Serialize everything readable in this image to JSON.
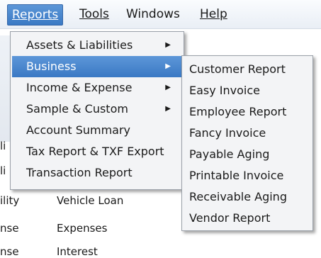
{
  "menubar": {
    "items": [
      {
        "label": "Reports",
        "active": true
      },
      {
        "label": "Tools"
      },
      {
        "label": "Windows"
      },
      {
        "label": "Help"
      }
    ]
  },
  "reports_menu": {
    "items": [
      {
        "label": "Assets & Liabilities",
        "submenu": true
      },
      {
        "label": "Business",
        "submenu": true,
        "highlighted": true
      },
      {
        "label": "Income & Expense",
        "submenu": true
      },
      {
        "label": "Sample & Custom",
        "submenu": true
      },
      {
        "label": "Account Summary"
      },
      {
        "label": "Tax Report & TXF Export"
      },
      {
        "label": "Transaction Report"
      }
    ]
  },
  "business_submenu": {
    "items": [
      {
        "label": "Customer Report"
      },
      {
        "label": "Easy Invoice"
      },
      {
        "label": "Employee Report"
      },
      {
        "label": "Fancy Invoice"
      },
      {
        "label": "Payable Aging"
      },
      {
        "label": "Printable Invoice"
      },
      {
        "label": "Receivable Aging"
      },
      {
        "label": "Vendor Report"
      }
    ]
  },
  "background_rows": [
    {
      "left": "li",
      "right": ""
    },
    {
      "left": "li",
      "right": ""
    },
    {
      "left": "ility",
      "right": "Vehicle Loan"
    },
    {
      "left": "nse",
      "right": "Expenses"
    },
    {
      "left": "nse",
      "right": "Interest"
    }
  ],
  "arrow_glyph": "▶"
}
